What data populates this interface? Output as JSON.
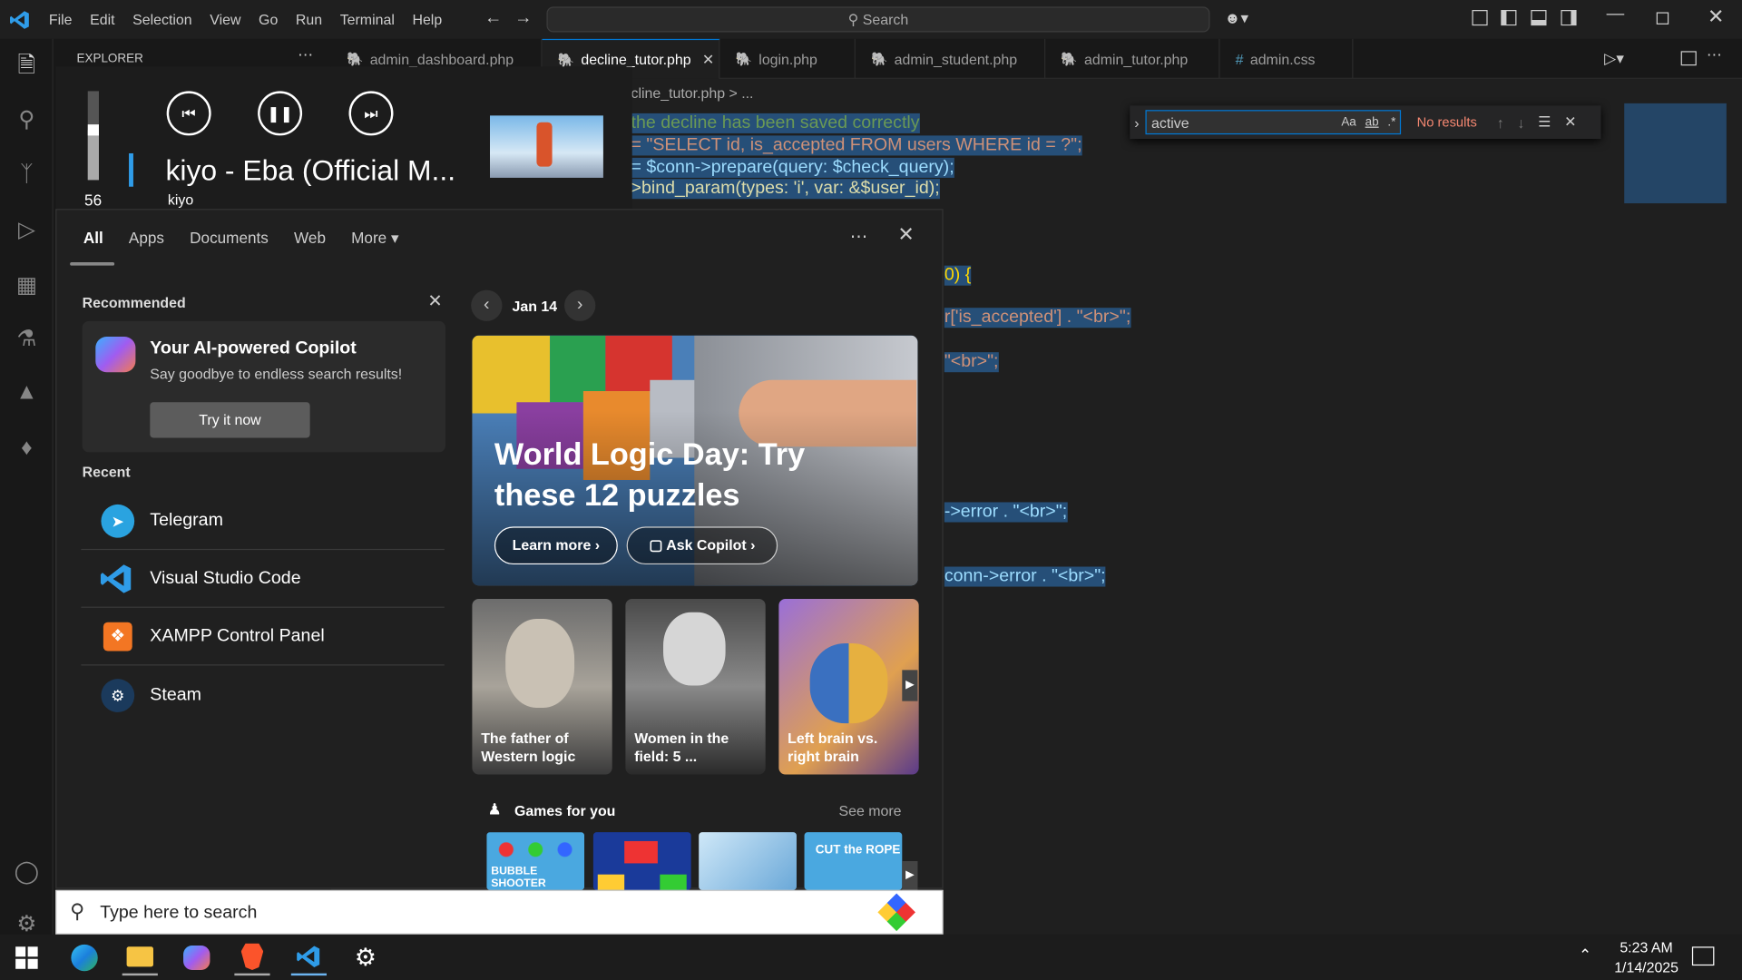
{
  "titlebar": {
    "menus": [
      "File",
      "Edit",
      "Selection",
      "View",
      "Go",
      "Run",
      "Terminal",
      "Help"
    ],
    "search": "Search"
  },
  "sidebar": {
    "title": "EXPLORER"
  },
  "tabs": [
    {
      "label": "admin_dashboard.php",
      "type": "php"
    },
    {
      "label": "decline_tutor.php",
      "type": "php",
      "active": true
    },
    {
      "label": "login.php",
      "type": "php"
    },
    {
      "label": "admin_student.php",
      "type": "php"
    },
    {
      "label": "admin_tutor.php",
      "type": "php"
    },
    {
      "label": "admin.css",
      "type": "css"
    }
  ],
  "breadcrumb": "cline_tutor.php > ...",
  "find": {
    "query": "active",
    "result": "No results",
    "opt_case": "Aa",
    "opt_word": "ab",
    "opt_regex": ".*"
  },
  "code": {
    "l1": "the decline has been saved correctly",
    "l2": "= \"SELECT id, is_accepted FROM users WHERE id = ?\";",
    "l3": "= $conn->prepare(query: $check_query);",
    "l4": ">bind_param(types: 'i', var: &$user_id);",
    "l5": "0) {",
    "l6": "r['is_accepted'] . \"<br>\";",
    "l7": "\"<br>\";",
    "l8": "->error . \"<br>\";",
    "l9": "conn->error . \"<br>\";"
  },
  "media": {
    "volume": "56",
    "title": "kiyo - Eba (Official M...",
    "artist": "kiyo"
  },
  "start": {
    "tabs": [
      "All",
      "Apps",
      "Documents",
      "Web",
      "More"
    ],
    "recommended_label": "Recommended",
    "copilot_title": "Your AI-powered Copilot",
    "copilot_desc": "Say goodbye to endless search results!",
    "copilot_btn": "Try it now",
    "recent_label": "Recent",
    "recent": [
      "Telegram",
      "Visual Studio Code",
      "XAMPP Control Panel",
      "Steam"
    ],
    "date": "Jan 14",
    "hero_title": "World Logic Day: Try these 12 puzzles",
    "learn_more": "Learn more",
    "ask_copilot": "Ask Copilot",
    "cards": [
      "The father of Western logic",
      "Women in the field: 5 ...",
      "Left brain vs. right brain"
    ],
    "games_label": "Games for you",
    "see_more": "See more",
    "game1": "BUBBLE SHOOTER",
    "game4": "CUT the ROPE"
  },
  "search_placeholder": "Type here to search",
  "clock": {
    "time": "5:23 AM",
    "date": "1/14/2025"
  },
  "colors": {
    "accent": "#0078d4",
    "php": "#a074c4",
    "css": "#519aba"
  }
}
